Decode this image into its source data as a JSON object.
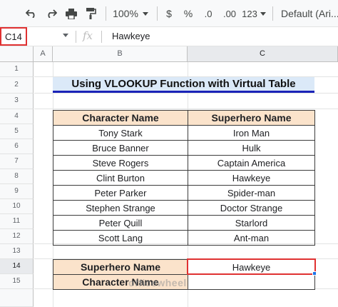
{
  "toolbar": {
    "zoom": "100%",
    "currency": "$",
    "percent": "%",
    "decrease_decimal": ".0",
    "increase_decimal": ".00",
    "more_formats": "123",
    "font": "Default (Ari..."
  },
  "formula_bar": {
    "name_box": "C14",
    "fx": "fx",
    "value": "Hawkeye"
  },
  "columns": [
    "A",
    "B",
    "C"
  ],
  "rows": [
    "1",
    "2",
    "3",
    "4",
    "5",
    "6",
    "7",
    "8",
    "9",
    "10",
    "11",
    "12",
    "13",
    "14",
    "15"
  ],
  "sheet": {
    "title": "Using VLOOKUP Function with Virtual Table",
    "table": {
      "headers": [
        "Character Name",
        "Superhero Name"
      ],
      "rows": [
        [
          "Tony Stark",
          "Iron Man"
        ],
        [
          "Bruce Banner",
          "Hulk"
        ],
        [
          "Steve Rogers",
          "Captain America"
        ],
        [
          "Clint Burton",
          "Hawkeye"
        ],
        [
          "Peter Parker",
          "Spider-man"
        ],
        [
          "Stephen Strange",
          "Doctor Strange"
        ],
        [
          "Peter Quill",
          "Starlord"
        ],
        [
          "Scott Lang",
          "Ant-man"
        ]
      ]
    },
    "lookup": {
      "superhero_label": "Superhero Name",
      "superhero_value": "Hawkeye",
      "character_label": "Character Name",
      "character_value": ""
    }
  },
  "watermark": "officewheel"
}
